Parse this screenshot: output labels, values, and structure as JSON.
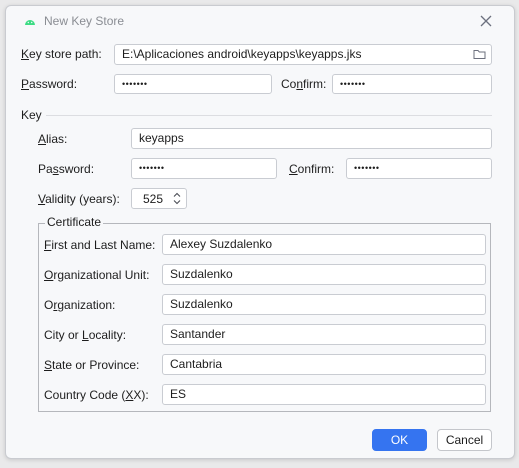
{
  "window": {
    "title": "New Key Store",
    "accent": "#3574f0"
  },
  "store": {
    "path_label_ul": "K",
    "path_label_rest": "ey store path:",
    "path_value": "E:\\Aplicaciones android\\keyapps\\keyapps.jks",
    "password_label_ul": "P",
    "password_label_rest": "assword:",
    "password_value": "•••••••",
    "confirm_label_pre": "Co",
    "confirm_label_ul": "n",
    "confirm_label_rest": "firm:",
    "confirm_value": "•••••••"
  },
  "key": {
    "section_label": "Key",
    "alias_label_ul": "A",
    "alias_label_rest": "lias:",
    "alias_value": "keyapps",
    "password_label_pre": "Pa",
    "password_label_ul": "s",
    "password_label_rest": "sword:",
    "password_value": "•••••••",
    "confirm_label_ul": "C",
    "confirm_label_rest": "onfirm:",
    "confirm_value": "•••••••",
    "validity_label_ul": "V",
    "validity_label_rest": "alidity (years):",
    "validity_value": "525"
  },
  "certificate": {
    "title": "Certificate",
    "fields": [
      {
        "label_ul": "F",
        "label_rest": "irst and Last Name:",
        "value": "Alexey Suzdalenko"
      },
      {
        "label_ul": "O",
        "label_rest": "rganizational Unit:",
        "value": "Suzdalenko"
      },
      {
        "label_pre": "O",
        "label_ul": "r",
        "label_rest": "ganization:",
        "value": "Suzdalenko"
      },
      {
        "label_pre": "City or ",
        "label_ul": "L",
        "label_rest": "ocality:",
        "value": "Santander"
      },
      {
        "label_ul": "S",
        "label_rest": "tate or Province:",
        "value": "Cantabria"
      },
      {
        "label_pre": "Country Code (",
        "label_ul": "X",
        "label_rest": "X):",
        "value": "ES"
      }
    ]
  },
  "buttons": {
    "ok": "OK",
    "cancel": "Cancel"
  },
  "icons": {
    "app": "android-icon",
    "close": "close-icon",
    "browse": "folder-icon",
    "spinner": "spinner-arrows-icon"
  }
}
